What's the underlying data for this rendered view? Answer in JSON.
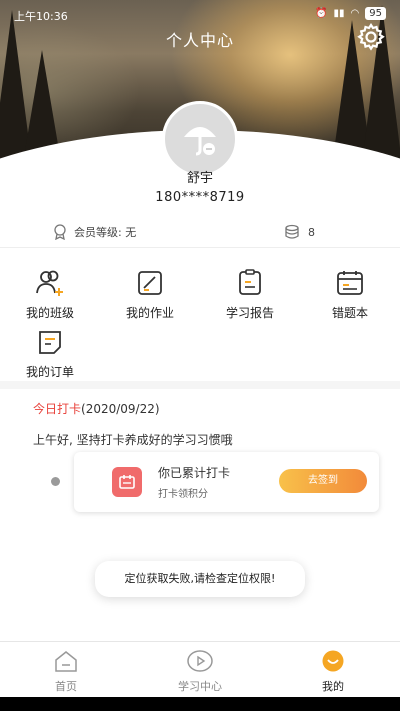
{
  "status_bar": {
    "time": "上午10:36",
    "battery": "95"
  },
  "header": {
    "title": "个人中心"
  },
  "user": {
    "name": "舒宇",
    "phone": "180****8719"
  },
  "member": {
    "level_label": "会员等级: 无",
    "coins": "8"
  },
  "grid": [
    {
      "label": "我的班级",
      "icon": "class-icon"
    },
    {
      "label": "我的作业",
      "icon": "homework-icon"
    },
    {
      "label": "学习报告",
      "icon": "report-icon"
    },
    {
      "label": "错题本",
      "icon": "mistake-book-icon"
    },
    {
      "label": "我的订单",
      "icon": "order-icon"
    }
  ],
  "checkin": {
    "title_highlight": "今日打卡",
    "title_date": "(2020/09/22)",
    "greeting": "上午好, 坚持打卡养成好的学习习惯哦",
    "card_line1": "你已累计打卡",
    "card_line2": "打卡领积分",
    "button": "去签到"
  },
  "toast": "定位获取失败,请检查定位权限!",
  "tabs": [
    {
      "label": "首页",
      "icon": "home-icon",
      "active": false
    },
    {
      "label": "学习中心",
      "icon": "play-icon",
      "active": false
    },
    {
      "label": "我的",
      "icon": "profile-icon",
      "active": true
    }
  ],
  "colors": {
    "accent_red": "#e8413a",
    "button_start": "#f8c14a",
    "button_end": "#f28a3a",
    "active_tab": "#f5a623"
  }
}
